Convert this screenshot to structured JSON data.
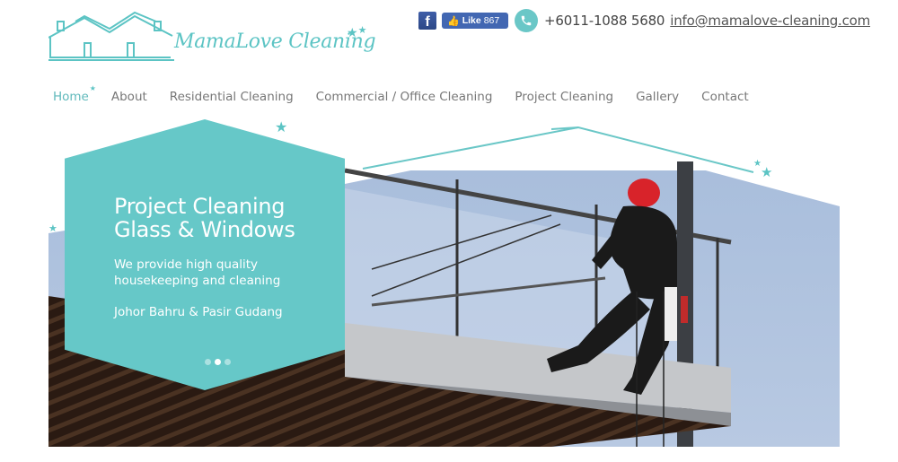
{
  "brand": {
    "name": "MamaLove Cleaning",
    "accent_color": "#66c8c8"
  },
  "topbar": {
    "facebook_icon": "facebook-icon",
    "like_label": "Like",
    "like_count": "867",
    "phone_icon": "phone-icon",
    "phone": "+6011-1088 5680",
    "email": "info@mamalove-cleaning.com"
  },
  "nav": {
    "items": [
      {
        "label": "Home",
        "active": true
      },
      {
        "label": "About"
      },
      {
        "label": "Residential Cleaning"
      },
      {
        "label": "Commercial / Office Cleaning"
      },
      {
        "label": "Project Cleaning"
      },
      {
        "label": "Gallery"
      },
      {
        "label": "Contact"
      }
    ]
  },
  "hero": {
    "title_line1": "Project Cleaning",
    "title_line2": "Glass & Windows",
    "subtitle_line1": "We provide high quality",
    "subtitle_line2": "housekeeping and cleaning",
    "location": "Johor Bahru & Pasir Gudang",
    "slides_total": 3,
    "active_slide": 2
  }
}
